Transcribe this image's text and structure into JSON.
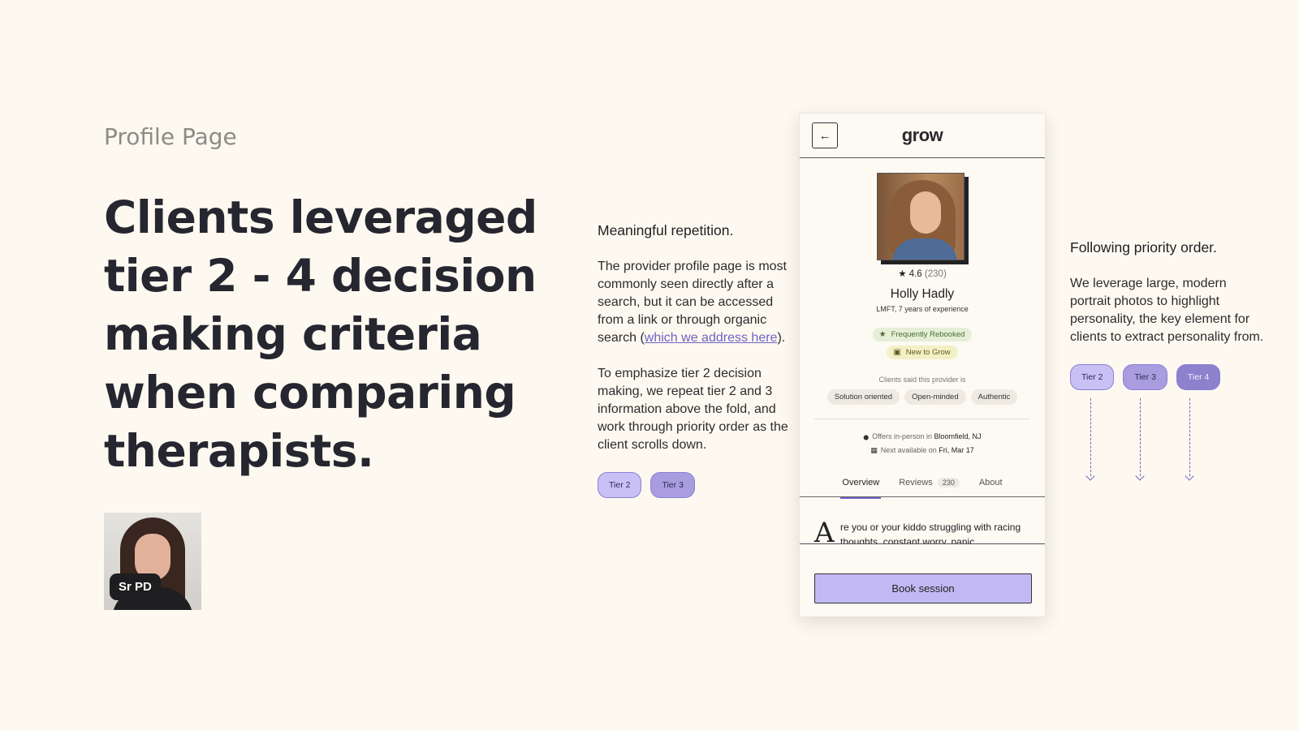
{
  "page": {
    "eyebrow": "Profile Page",
    "headline": "Clients leveraged tier 2 - 4 decision making criteria when comparing therapists.",
    "author_badge": "Sr PD"
  },
  "middle": {
    "heading": "Meaningful repetition.",
    "p1_before": "The provider profile page is most commonly seen directly after a search, but it can be accessed from a link or through organic search (",
    "p1_link": "which we address here",
    "p1_after": ").",
    "p2": "To emphasize tier 2 decision making, we repeat tier 2 and 3 information above the fold, and work through priority order as the client scrolls down.",
    "chips": [
      "Tier 2",
      "Tier 3"
    ]
  },
  "right": {
    "heading": "Following priority order.",
    "p1": "We leverage large, modern portrait photos to highlight personality, the key element for clients to extract personality from.",
    "chips": [
      "Tier 2",
      "Tier 3",
      "Tier 4"
    ]
  },
  "phone": {
    "back_icon": "←",
    "logo": "grow",
    "rating_star": "★",
    "rating": "4.6",
    "rating_count": "(230)",
    "name": "Holly Hadly",
    "credentials": "LMFT, 7 years of experience",
    "badge_green": "Frequently Rebooked",
    "badge_green_icon": "★",
    "badge_yellow": "New to Grow",
    "badge_yellow_icon": "▣",
    "said_label": "Clients said this provider is",
    "traits": [
      "Solution oriented",
      "Open-minded",
      "Authentic"
    ],
    "location_prefix": "Offers in-person in",
    "location": "Bloomfield, NJ",
    "location_icon": "⬤",
    "avail_prefix": "Next available on",
    "avail": "Fri, Mar 17",
    "avail_icon": "▦",
    "tabs": [
      {
        "label": "Overview",
        "active": true
      },
      {
        "label": "Reviews",
        "count": "230"
      },
      {
        "label": "About"
      }
    ],
    "bio_drop": "A",
    "bio_text": "re you or your kiddo struggling with racing thoughts, constant worry, panic,",
    "book_label": "Book session"
  },
  "colors": {
    "background": "#fdf9f0",
    "accent": "#6e62c6",
    "tier2": "#c9c0f5",
    "tier3": "#a99de0",
    "tier4": "#8d80cc",
    "book": "#c2b9f4"
  }
}
